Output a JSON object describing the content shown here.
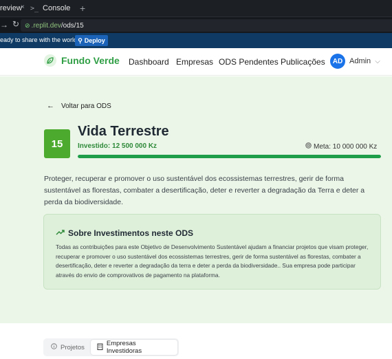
{
  "browser": {
    "tabs": [
      {
        "label": "review",
        "close": "×"
      },
      {
        "label": "Console",
        "prefix": ">_"
      }
    ],
    "new_tab": "+",
    "url_host": ".replit.dev",
    "url_path": "/ods/15",
    "deploy_prompt": "eady to share with the world?",
    "deploy_button": "Deploy"
  },
  "header": {
    "brand": "Fundo Verde",
    "nav": [
      "Dashboard",
      "Empresas",
      "ODS Pendentes",
      "Publicações"
    ],
    "user_initials": "AD",
    "user_name": "Admin"
  },
  "ods": {
    "back_label": "Voltar para ODS",
    "number": "15",
    "title": "Vida Terrestre",
    "invested": "Investido: 12 500 000 Kz",
    "meta": "Meta: 10 000 000 Kz",
    "progress": 1.0,
    "description": "Proteger, recuperar e promover o uso sustentável dos ecossistemas terrestres, gerir de forma sustentável as florestas, combater a desertificação, deter e reverter a degradação da Terra e deter a perda da biodiversidade."
  },
  "info": {
    "title": "Sobre Investimentos neste ODS",
    "body": "Todas as contribuições para este Objetivo de Desenvolvimento Sustentável ajudam a financiar projetos que visam proteger, recuperar e promover o uso sustentável dos ecossistemas terrestres, gerir de forma sustentável as florestas, combater a desertificação, deter e reverter a degradação da terra e deter a perda da biodiversidade.. Sua empresa pode participar através do envio de comprovativos de pagamento na plataforma."
  },
  "tabs": {
    "projects": "Projetos",
    "companies": "Empresas Investidoras"
  },
  "colors": {
    "brand_green": "#2f9e44",
    "ods15_green": "#4caa2e",
    "hero_bg": "#ebf6e8"
  }
}
